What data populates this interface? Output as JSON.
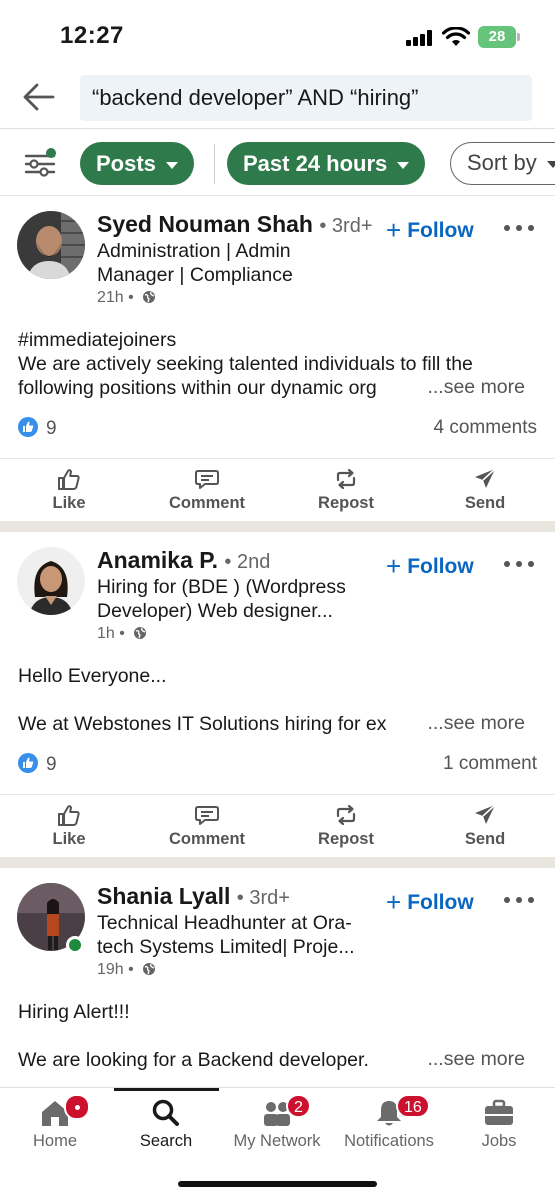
{
  "status_bar": {
    "time": "12:27",
    "battery": "28"
  },
  "search": {
    "query": "“backend developer” AND “hiring”"
  },
  "filters": {
    "posts_label": "Posts",
    "time_label": "Past 24 hours",
    "sort_label": "Sort by"
  },
  "posts": [
    {
      "author": "Syed Nouman Shah",
      "degree": "• 3rd+",
      "headline": "Administration | Admin Manager | Compliance",
      "time": "21h •",
      "follow_label": "Follow",
      "text_lines": [
        "#immediatejoiners",
        "We are actively seeking talented individuals to fill the",
        "following positions within our dynamic org"
      ],
      "see_more": "...see more",
      "reactions": "9",
      "comments": "4 comments"
    },
    {
      "author": "Anamika P.",
      "degree": "• 2nd",
      "headline": "Hiring for (BDE ) (Wordpress Developer) Web designer...",
      "time": "1h •",
      "follow_label": "Follow",
      "text_lines": [
        "Hello Everyone...",
        "",
        "We at Webstones IT Solutions hiring for ex"
      ],
      "see_more": "...see more",
      "reactions": "9",
      "comments": "1 comment"
    },
    {
      "author": "Shania Lyall",
      "degree": "• 3rd+",
      "headline": "Technical Headhunter at Ora-tech Systems Limited| Proje...",
      "time": "19h •",
      "follow_label": "Follow",
      "text_lines": [
        "Hiring Alert!!!",
        "",
        "We are looking for a Backend developer."
      ],
      "see_more": "...see more"
    }
  ],
  "actions": {
    "like": "Like",
    "comment": "Comment",
    "repost": "Repost",
    "send": "Send"
  },
  "tabs": {
    "home": "Home",
    "search": "Search",
    "network": "My Network",
    "network_badge": "2",
    "notifications": "Notifications",
    "notifications_badge": "16",
    "jobs": "Jobs"
  },
  "colors": {
    "accent_green": "#2f7a4a",
    "link_blue": "#0a66c2",
    "badge_red": "#cb112d"
  }
}
